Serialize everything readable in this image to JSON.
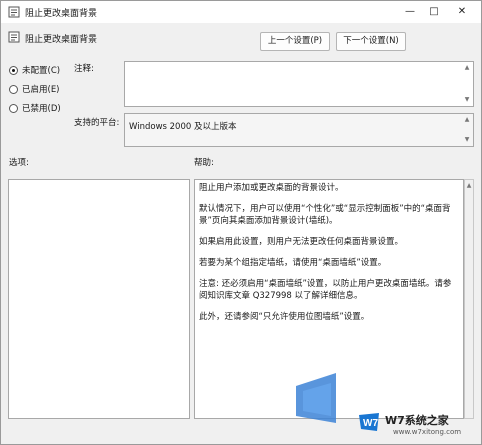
{
  "window": {
    "title": "阻止更改桌面背景"
  },
  "header": {
    "title": "阻止更改桌面背景"
  },
  "nav": {
    "prev_label": "上一个设置(P)",
    "next_label": "下一个设置(N)"
  },
  "options": {
    "not_configured": "未配置(C)",
    "enabled": "已启用(E)",
    "disabled": "已禁用(D)",
    "selected": "not_configured"
  },
  "comment": {
    "label": "注释:",
    "value": ""
  },
  "platform": {
    "label": "支持的平台:",
    "value": "Windows 2000 及以上版本"
  },
  "sections": {
    "options_label": "选项:",
    "help_label": "帮助:"
  },
  "help": {
    "p1": "阻止用户添加或更改桌面的背景设计。",
    "p2": "默认情况下，用户可以使用“个性化”或“显示控制面板”中的“桌面背景”页向其桌面添加背景设计(墙纸)。",
    "p3": "如果启用此设置，则用户无法更改任何桌面背景设置。",
    "p4": "若要为某个组指定墙纸，请使用“桌面墙纸”设置。",
    "p5": "注意: 还必须启用“桌面墙纸”设置，以防止用户更改桌面墙纸。请参阅知识库文章 Q327998 以了解详细信息。",
    "p6": "此外，还请参阅“只允许使用位图墙纸”设置。"
  },
  "watermark": {
    "brand": "W7系统之家",
    "url": "www.w7xitong.com"
  }
}
